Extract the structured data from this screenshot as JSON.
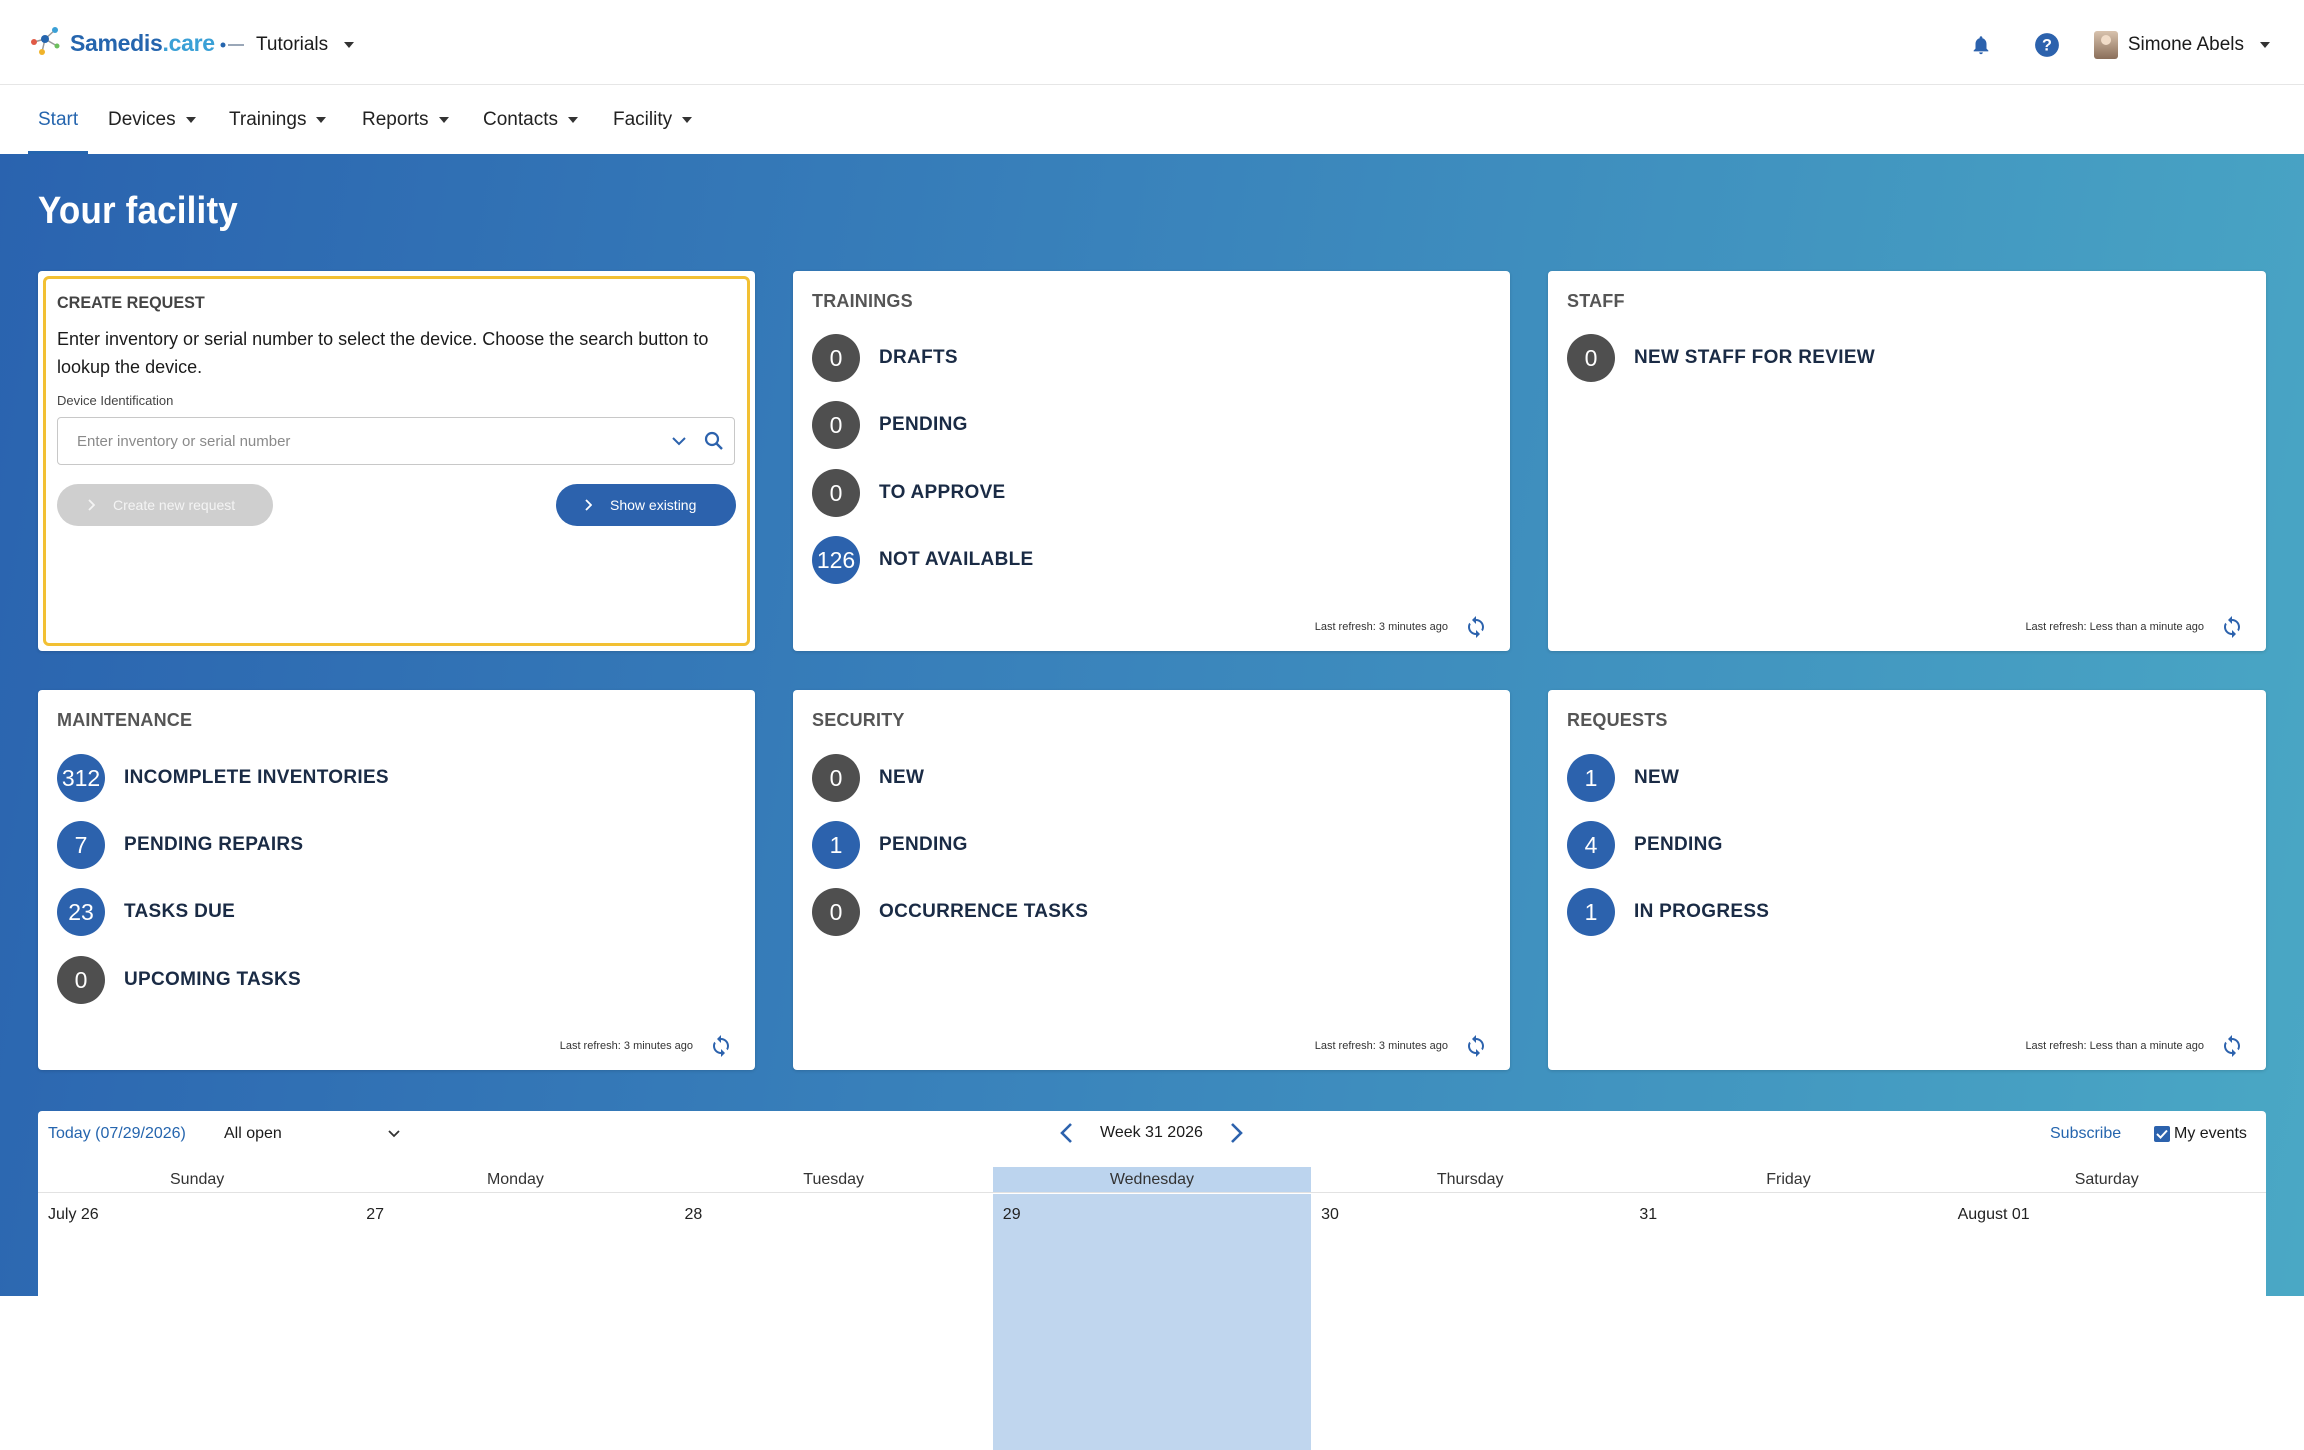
{
  "header": {
    "brand_name": "Samedis",
    "brand_suffix": ".care",
    "tenant": "Tutorials",
    "user": "Simone Abels"
  },
  "icons": {
    "brand": "samedis-logo-icon",
    "bell": "bell-icon",
    "help": "help-circle-icon",
    "refresh": "refresh-icon",
    "search": "search-icon"
  },
  "nav": {
    "items": [
      {
        "label": "Start"
      },
      {
        "label": "Devices"
      },
      {
        "label": "Trainings"
      },
      {
        "label": "Reports"
      },
      {
        "label": "Contacts"
      },
      {
        "label": "Facility"
      }
    ]
  },
  "page_title": "Your facility",
  "create_request": {
    "title": "CREATE REQUEST",
    "description": "Enter inventory or serial number to select the device. Choose the search button to lookup the device.",
    "field_label": "Device Identification",
    "placeholder": "Enter inventory or serial number",
    "create_button": "Create new request",
    "show_button": "Show existing"
  },
  "trainings": {
    "title": "TRAININGS",
    "stats": [
      {
        "value": "0",
        "label": "DRAFTS"
      },
      {
        "value": "0",
        "label": "PENDING"
      },
      {
        "value": "0",
        "label": "TO APPROVE"
      },
      {
        "value": "126",
        "label": "NOT AVAILABLE"
      }
    ],
    "refresh": "Last refresh: 3 minutes ago"
  },
  "staff": {
    "title": "STAFF",
    "stats": [
      {
        "value": "0",
        "label": "NEW STAFF FOR REVIEW"
      }
    ],
    "refresh": "Last refresh: Less than a minute ago"
  },
  "maintenance": {
    "title": "MAINTENANCE",
    "stats": [
      {
        "value": "312",
        "label": "INCOMPLETE INVENTORIES"
      },
      {
        "value": "7",
        "label": "PENDING REPAIRS"
      },
      {
        "value": "23",
        "label": "TASKS DUE"
      },
      {
        "value": "0",
        "label": "UPCOMING TASKS"
      }
    ],
    "refresh": "Last refresh: 3 minutes ago"
  },
  "security": {
    "title": "SECURITY",
    "stats": [
      {
        "value": "0",
        "label": "NEW"
      },
      {
        "value": "1",
        "label": "PENDING"
      },
      {
        "value": "0",
        "label": "OCCURRENCE TASKS"
      }
    ],
    "refresh": "Last refresh: 3 minutes ago"
  },
  "requests": {
    "title": "REQUESTS",
    "stats": [
      {
        "value": "1",
        "label": "NEW"
      },
      {
        "value": "4",
        "label": "PENDING"
      },
      {
        "value": "1",
        "label": "IN PROGRESS"
      }
    ],
    "refresh": "Last refresh: Less than a minute ago"
  },
  "calendar": {
    "today": "Today (07/29/2026)",
    "filter": "All open",
    "week": "Week 31 2026",
    "subscribe": "Subscribe",
    "my_events": "My events",
    "days": [
      "Sunday",
      "Monday",
      "Tuesday",
      "Wednesday",
      "Thursday",
      "Friday",
      "Saturday"
    ],
    "dates": [
      "July 26",
      "27",
      "28",
      "29",
      "30",
      "31",
      "August 01"
    ]
  },
  "colors": {
    "primary": "#2c62ad",
    "highlight_border": "#f2c033",
    "badge_zero": "#4f4f4f",
    "today_bg": "#c0d6ee"
  }
}
